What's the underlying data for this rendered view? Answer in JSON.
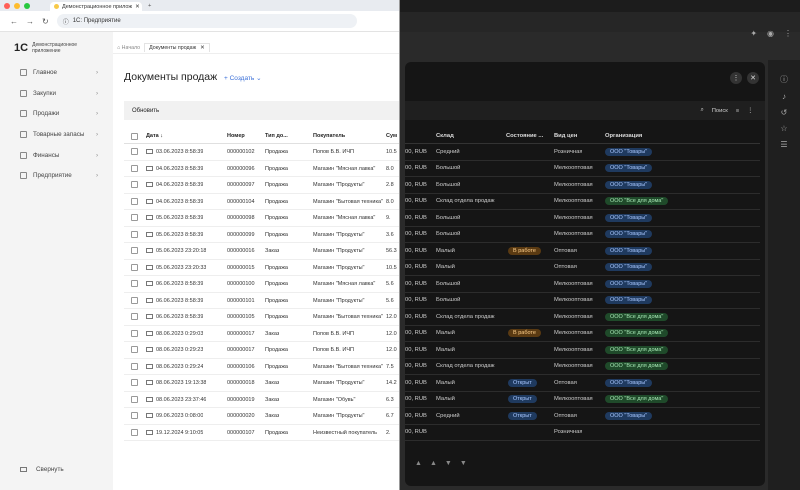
{
  "browser": {
    "tab_title": "Демонстрационное прилож",
    "url": "1С: Предприятие"
  },
  "app": {
    "logo": "1С",
    "name": "Демонстрационное приложение"
  },
  "sidebar": {
    "items": [
      {
        "label": "Главное"
      },
      {
        "label": "Закупки"
      },
      {
        "label": "Продажи"
      },
      {
        "label": "Товарные запасы"
      },
      {
        "label": "Финансы"
      },
      {
        "label": "Предприятие"
      }
    ],
    "collapse": "Свернуть"
  },
  "breadcrumb": {
    "home": "Начало",
    "current": "Документы продаж"
  },
  "page": {
    "title": "Документы продаж",
    "create": "Создать"
  },
  "toolbar": {
    "refresh": "Обновить",
    "search": "Поиск"
  },
  "table": {
    "columns": {
      "date": "Дата",
      "number": "Номер",
      "type": "Тип до...",
      "buyer": "Покупатель",
      "sum": "Сум",
      "warehouse": "Склад",
      "state": "Состояние ...",
      "price": "Вид цен",
      "org": "Организация"
    },
    "rows": [
      {
        "date": "03.06.2023 8:58:39",
        "number": "000000102",
        "type": "Продажа",
        "buyer": "Попов Б.В. ИЧП",
        "sum": "10.5",
        "cur": "00, RUB",
        "warehouse": "Средний",
        "state": "",
        "price": "Розничная",
        "org": "ООО \"Товары\"",
        "org_color": "blue"
      },
      {
        "date": "04.06.2023 8:58:39",
        "number": "000000096",
        "type": "Продажа",
        "buyer": "Магазин \"Мясная лавка\"",
        "sum": "8.0",
        "cur": "00, RUB",
        "warehouse": "Большой",
        "state": "",
        "price": "Мелкооптовая",
        "org": "ООО \"Товары\"",
        "org_color": "blue"
      },
      {
        "date": "04.06.2023 8:58:39",
        "number": "000000097",
        "type": "Продажа",
        "buyer": "Магазин \"Продукты\"",
        "sum": "2.8",
        "cur": "00, RUB",
        "warehouse": "Большой",
        "state": "",
        "price": "Мелкооптовая",
        "org": "ООО \"Товары\"",
        "org_color": "blue"
      },
      {
        "date": "04.06.2023 8:58:39",
        "number": "000000104",
        "type": "Продажа",
        "buyer": "Магазин \"Бытовая техника\"",
        "sum": "8.0",
        "cur": "00, RUB",
        "warehouse": "Склад отдела продаж",
        "state": "",
        "price": "Мелкооптовая",
        "org": "ООО \"Все для дома\"",
        "org_color": "green"
      },
      {
        "date": "05.06.2023 8:58:39",
        "number": "000000098",
        "type": "Продажа",
        "buyer": "Магазин \"Мясная лавка\"",
        "sum": "9.",
        "cur": "00, RUB",
        "warehouse": "Большой",
        "state": "",
        "price": "Мелкооптовая",
        "org": "ООО \"Товары\"",
        "org_color": "blue"
      },
      {
        "date": "05.06.2023 8:58:39",
        "number": "000000099",
        "type": "Продажа",
        "buyer": "Магазин \"Продукты\"",
        "sum": "3.6",
        "cur": "00, RUB",
        "warehouse": "Большой",
        "state": "",
        "price": "Мелкооптовая",
        "org": "ООО \"Товары\"",
        "org_color": "blue"
      },
      {
        "date": "05.06.2023 23:20:18",
        "number": "000000016",
        "type": "Заказ",
        "buyer": "Магазин \"Продукты\"",
        "sum": "56.3",
        "cur": "00, RUB",
        "warehouse": "Малый",
        "state": "В работе",
        "state_color": "orange",
        "price": "Оптовая",
        "org": "ООО \"Товары\"",
        "org_color": "blue"
      },
      {
        "date": "05.06.2023 23:20:33",
        "number": "000000015",
        "type": "Продажа",
        "buyer": "Магазин \"Продукты\"",
        "sum": "10.5",
        "cur": "00, RUB",
        "warehouse": "Малый",
        "state": "",
        "price": "Оптовая",
        "org": "ООО \"Товары\"",
        "org_color": "blue"
      },
      {
        "date": "06.06.2023 8:58:39",
        "number": "000000100",
        "type": "Продажа",
        "buyer": "Магазин \"Мясная лавка\"",
        "sum": "5.6",
        "cur": "00, RUB",
        "warehouse": "Большой",
        "state": "",
        "price": "Мелкооптовая",
        "org": "ООО \"Товары\"",
        "org_color": "blue"
      },
      {
        "date": "06.06.2023 8:58:39",
        "number": "000000101",
        "type": "Продажа",
        "buyer": "Магазин \"Продукты\"",
        "sum": "5.6",
        "cur": "00, RUB",
        "warehouse": "Большой",
        "state": "",
        "price": "Мелкооптовая",
        "org": "ООО \"Товары\"",
        "org_color": "blue"
      },
      {
        "date": "06.06.2023 8:58:39",
        "number": "000000105",
        "type": "Продажа",
        "buyer": "Магазин \"Бытовая техника\"",
        "sum": "12.0",
        "cur": "00, RUB",
        "warehouse": "Склад отдела продаж",
        "state": "",
        "price": "Мелкооптовая",
        "org": "ООО \"Все для дома\"",
        "org_color": "green"
      },
      {
        "date": "08.06.2023 0:29:03",
        "number": "000000017",
        "type": "Заказ",
        "buyer": "Попов Б.В. ИЧП",
        "sum": "12.0",
        "cur": "00, RUB",
        "warehouse": "Малый",
        "state": "В работе",
        "state_color": "orange",
        "price": "Мелкооптовая",
        "org": "ООО \"Все для дома\"",
        "org_color": "green"
      },
      {
        "date": "08.06.2023 0:29:23",
        "number": "000000017",
        "type": "Продажа",
        "buyer": "Попов Б.В. ИЧП",
        "sum": "12.0",
        "cur": "00, RUB",
        "warehouse": "Малый",
        "state": "",
        "price": "Мелкооптовая",
        "org": "ООО \"Все для дома\"",
        "org_color": "green"
      },
      {
        "date": "08.06.2023 0:29:24",
        "number": "000000106",
        "type": "Продажа",
        "buyer": "Магазин \"Бытовая техника\"",
        "sum": "7.5",
        "cur": "00, RUB",
        "warehouse": "Склад отдела продаж",
        "state": "",
        "price": "Мелкооптовая",
        "org": "ООО \"Все для дома\"",
        "org_color": "green"
      },
      {
        "date": "08.06.2023 19:13:38",
        "number": "000000018",
        "type": "Заказ",
        "buyer": "Магазин \"Продукты\"",
        "sum": "14.2",
        "cur": "00, RUB",
        "warehouse": "Малый",
        "state": "Открыт",
        "state_color": "open",
        "price": "Оптовая",
        "org": "ООО \"Товары\"",
        "org_color": "blue"
      },
      {
        "date": "08.06.2023 23:37:46",
        "number": "000000019",
        "type": "Заказ",
        "buyer": "Магазин \"Обувь\"",
        "sum": "6.3",
        "cur": "00, RUB",
        "warehouse": "Малый",
        "state": "Открыт",
        "state_color": "open",
        "price": "Мелкооптовая",
        "org": "ООО \"Все для дома\"",
        "org_color": "green"
      },
      {
        "date": "09.06.2023 0:08:00",
        "number": "000000020",
        "type": "Заказ",
        "buyer": "Магазин \"Продукты\"",
        "sum": "6.7",
        "cur": "00, RUB",
        "warehouse": "Средний",
        "state": "Открыт",
        "state_color": "open",
        "price": "Оптовая",
        "org": "ООО \"Товары\"",
        "org_color": "blue"
      },
      {
        "date": "19.12.2024 9:10:05",
        "number": "000000107",
        "type": "Продажа",
        "buyer": "Неизвестный покупатель",
        "sum": "2.",
        "cur": "00, RUB",
        "warehouse": "",
        "state": "",
        "price": "Розничная",
        "org": "",
        "org_color": ""
      }
    ]
  }
}
